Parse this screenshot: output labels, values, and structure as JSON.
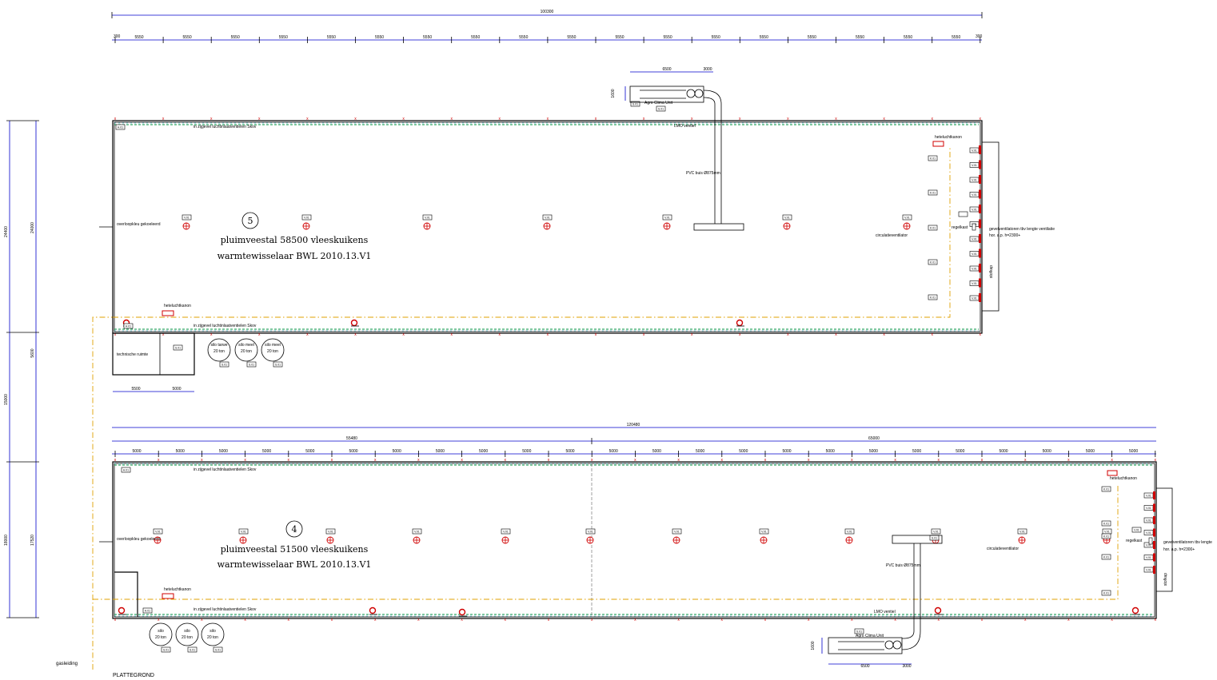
{
  "drawing_title": "PLATTEGROND",
  "gas_label": "gasleiding",
  "top_overall_dim": "100300",
  "top_left_end_dim": "300",
  "top_right_end_dim": "300",
  "top_bay_dim": "5550",
  "left_dims": {
    "stal5_width": "24400",
    "stal5_inner": "24000",
    "gap": "15000",
    "gap_inner": "5600",
    "stal4_width": "18000",
    "stal4_inner": "17520",
    "end": "200"
  },
  "stal5": {
    "number": "5",
    "title": "pluimveestal 58500 vleeskuikens",
    "subtitle": "warmtewisselaar BWL 2010.13.V1",
    "inlet_top": "in zijgevel luchtinlaatventielen Skov",
    "inlet_bottom": "in zijgevel luchtinlaatventielen Skov",
    "heater": "heteluchtkanon",
    "heater_bottom": "heteluchtkanon",
    "ventilator": "circulatieventilator",
    "control": "regelkast",
    "gable_fans": "gevelventilatoren tbv lengte ventilatie",
    "gable_fans_sub": "hor. a.p. h=2300+",
    "shutter": "stofkap",
    "left_note": "overloopkleu gekoeleerd",
    "tech_room": "technische ruimte",
    "unit": "Agro Clima Unit",
    "pipe": "PVC buis Ø875mm",
    "ducts": "LMO ventiel",
    "unit_dim_a": "6500",
    "unit_dim_b": "3000",
    "unit_dim_h": "1600",
    "tech_dim_a": "5500",
    "tech_dim_b": "5000",
    "silos": [
      {
        "line1": "silo tarwe",
        "line2": "20 ton"
      },
      {
        "line1": "silo meel",
        "line2": "20 ton"
      },
      {
        "line1": "silo meel",
        "line2": "20 ton"
      }
    ]
  },
  "stal4": {
    "number": "4",
    "title": "pluimveestal 51500 vleeskuikens",
    "subtitle": "warmtewisselaar BWL 2010.13.V1",
    "inlet_top": "in zijgevel luchtinlaatventielen Skov",
    "inlet_bottom": "in zijgevel luchtinlaatventielen Skov",
    "heater": "heteluchtkanon",
    "heater_right": "heteluchtkanon",
    "ventilator": "circulatieventilator",
    "control": "regelkast",
    "gable_fans": "gevelventilatoren tbv lengte",
    "gable_fans_sub": "hor. a.p. h=2300+",
    "shutter": "stofkap",
    "left_note": "overloopkleu gekoeleerd",
    "unit": "Agro Clima Unit",
    "pipe": "PVC buis Ø875mm",
    "ducts": "LMO ventiel",
    "overall_dim": "120480",
    "left_part_dim": "55480",
    "right_part_dim": "65000",
    "bay_dim": "5000",
    "end_dim": "300",
    "unit_dim_a": "6500",
    "unit_dim_b": "3000",
    "unit_dim_h": "1600",
    "silos": [
      {
        "line1": "silo",
        "line2": "20 ton"
      },
      {
        "line1": "silo",
        "line2": "20 ton"
      },
      {
        "line1": "silo",
        "line2": "20 ton"
      }
    ]
  },
  "tag_v": "V.01",
  "tag_h": "H.01",
  "tag_k": "K.01",
  "tag_s": "S.01",
  "colors": {
    "dim": "#0000cc",
    "wall": "#000000",
    "yellow": "#e0a000",
    "green": "#009040",
    "red": "#d00000"
  }
}
